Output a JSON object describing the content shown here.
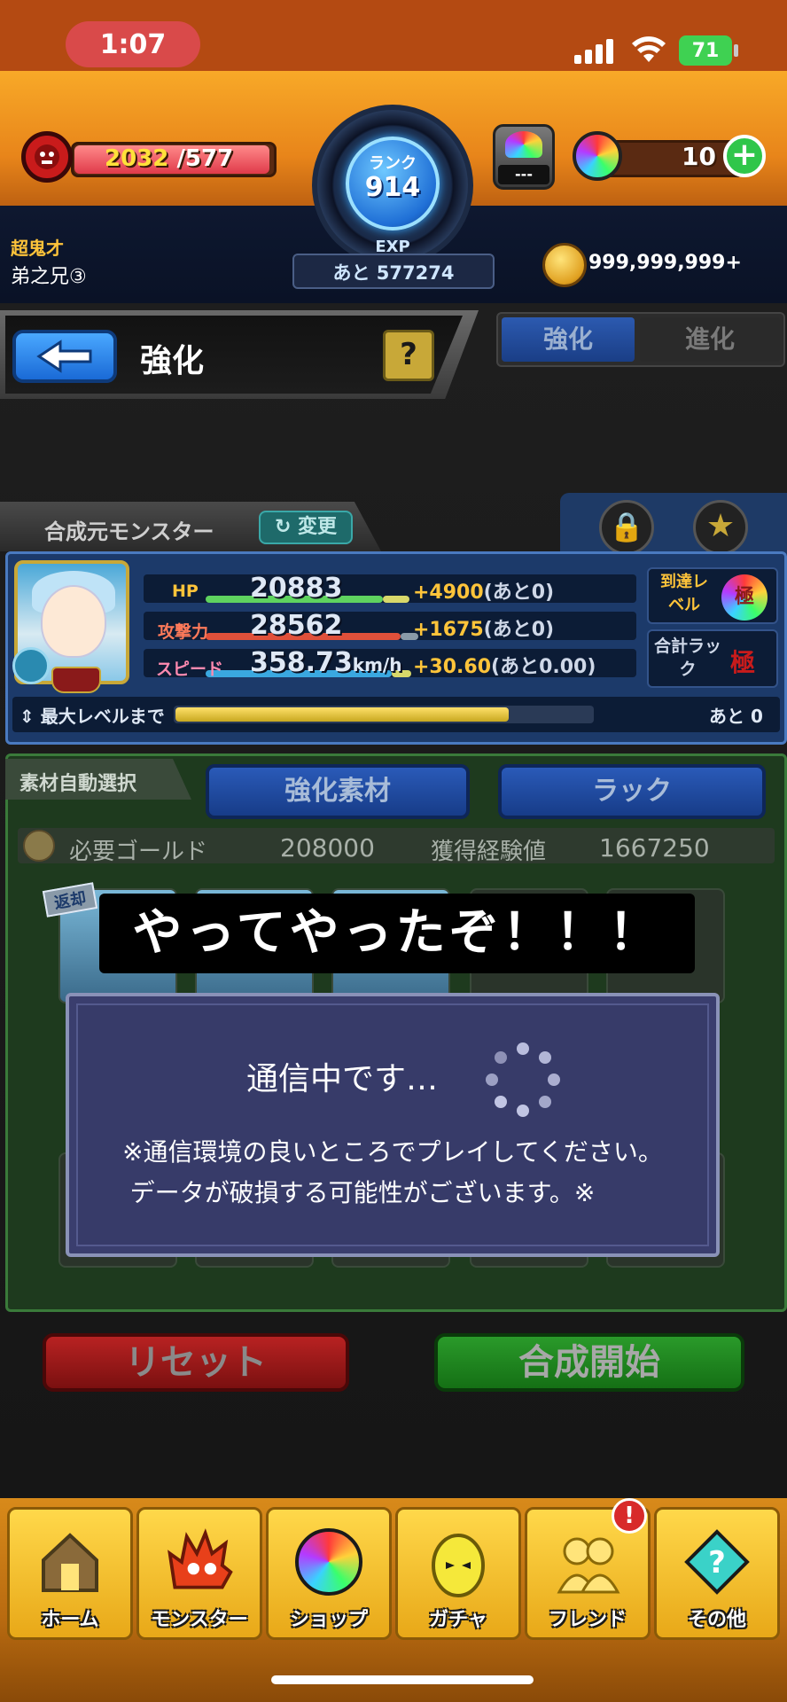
{
  "status_bar": {
    "time": "1:07",
    "battery": "71"
  },
  "header": {
    "stamina": {
      "current": "2032",
      "max": "/577"
    },
    "rank": {
      "label": "ランク",
      "value": "914"
    },
    "exp": {
      "label": "EXP",
      "remaining": "あと 577274"
    },
    "mystery_box_label": "---",
    "orb_count": "10",
    "title_label": "超鬼才",
    "player_name": "弟之兄③",
    "gold": "999,999,999+"
  },
  "page": {
    "title": "強化",
    "help_label": "?",
    "tabs": [
      {
        "label": "強化",
        "active": true
      },
      {
        "label": "進化",
        "active": false
      }
    ]
  },
  "source_monster": {
    "tab_label": "合成元モンスター",
    "change_label": "変更",
    "stats": [
      {
        "label": "HP",
        "value": "20883",
        "bonus": "+4900",
        "remaining": "(あと0)",
        "color": "#5fd35f"
      },
      {
        "label": "攻撃力",
        "value": "28562",
        "bonus": "+1675",
        "remaining": "(あと0)",
        "color": "#e0503a"
      },
      {
        "label": "スピード",
        "value": "358.73",
        "unit": "km/h",
        "bonus": "+30.60",
        "remaining": "(あと0.00)",
        "color": "#3aa8e0"
      }
    ],
    "reach_level_label": "到達レベル",
    "reach_level_badge": "極",
    "total_luck_label": "合計ラック",
    "max_level_label": "最大レベルまで",
    "max_level_remaining": "あと 0",
    "max_level_progress": 0.8
  },
  "materials": {
    "auto_select_label": "素材自動選択",
    "material_button": "強化素材",
    "luck_button": "ラック",
    "gold_required_label": "必要ゴールド",
    "gold_required_value": "208000",
    "exp_gain_label": "獲得経験値",
    "exp_gain_value": "1667250",
    "return_badge": "返却"
  },
  "caption": "やってやったぞ！！！",
  "dialog": {
    "title": "通信中です…",
    "line1": "※通信環境の良いところでプレイしてください。",
    "line2": "データが破損する可能性がございます。※"
  },
  "actions": {
    "reset": "リセット",
    "combine": "合成開始"
  },
  "nav": [
    {
      "label": "ホーム",
      "icon": "home-icon"
    },
    {
      "label": "モンスター",
      "icon": "monster-icon"
    },
    {
      "label": "ショップ",
      "icon": "orb-icon"
    },
    {
      "label": "ガチャ",
      "icon": "gacha-egg-icon"
    },
    {
      "label": "フレンド",
      "icon": "friends-icon"
    },
    {
      "label": "その他",
      "icon": "other-icon"
    }
  ],
  "friend_alert": "!"
}
